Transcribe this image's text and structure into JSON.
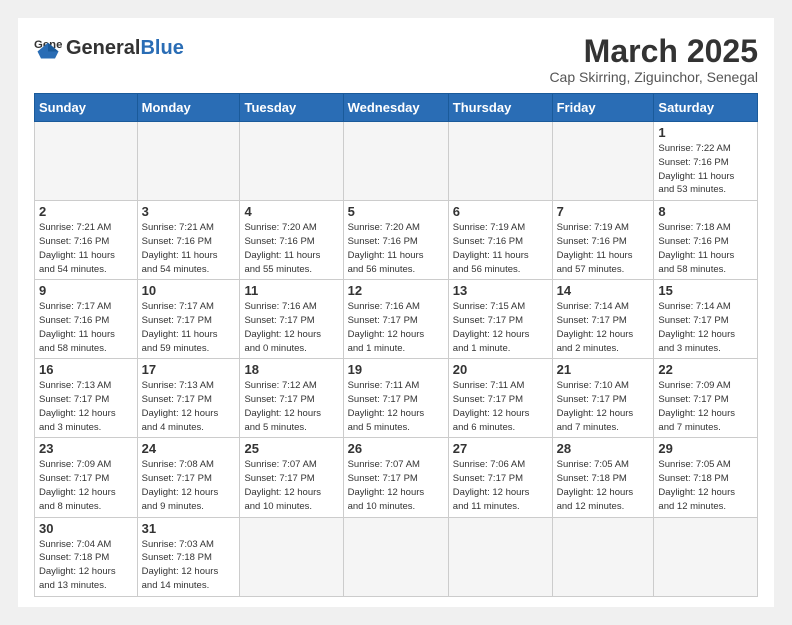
{
  "logo": {
    "text_general": "General",
    "text_blue": "Blue"
  },
  "header": {
    "title": "March 2025",
    "subtitle": "Cap Skirring, Ziguinchor, Senegal"
  },
  "weekdays": [
    "Sunday",
    "Monday",
    "Tuesday",
    "Wednesday",
    "Thursday",
    "Friday",
    "Saturday"
  ],
  "weeks": [
    [
      {
        "day": "",
        "info": ""
      },
      {
        "day": "",
        "info": ""
      },
      {
        "day": "",
        "info": ""
      },
      {
        "day": "",
        "info": ""
      },
      {
        "day": "",
        "info": ""
      },
      {
        "day": "",
        "info": ""
      },
      {
        "day": "1",
        "info": "Sunrise: 7:22 AM\nSunset: 7:16 PM\nDaylight: 11 hours\nand 53 minutes."
      }
    ],
    [
      {
        "day": "2",
        "info": "Sunrise: 7:21 AM\nSunset: 7:16 PM\nDaylight: 11 hours\nand 54 minutes."
      },
      {
        "day": "3",
        "info": "Sunrise: 7:21 AM\nSunset: 7:16 PM\nDaylight: 11 hours\nand 54 minutes."
      },
      {
        "day": "4",
        "info": "Sunrise: 7:20 AM\nSunset: 7:16 PM\nDaylight: 11 hours\nand 55 minutes."
      },
      {
        "day": "5",
        "info": "Sunrise: 7:20 AM\nSunset: 7:16 PM\nDaylight: 11 hours\nand 56 minutes."
      },
      {
        "day": "6",
        "info": "Sunrise: 7:19 AM\nSunset: 7:16 PM\nDaylight: 11 hours\nand 56 minutes."
      },
      {
        "day": "7",
        "info": "Sunrise: 7:19 AM\nSunset: 7:16 PM\nDaylight: 11 hours\nand 57 minutes."
      },
      {
        "day": "8",
        "info": "Sunrise: 7:18 AM\nSunset: 7:16 PM\nDaylight: 11 hours\nand 58 minutes."
      }
    ],
    [
      {
        "day": "9",
        "info": "Sunrise: 7:17 AM\nSunset: 7:16 PM\nDaylight: 11 hours\nand 58 minutes."
      },
      {
        "day": "10",
        "info": "Sunrise: 7:17 AM\nSunset: 7:17 PM\nDaylight: 11 hours\nand 59 minutes."
      },
      {
        "day": "11",
        "info": "Sunrise: 7:16 AM\nSunset: 7:17 PM\nDaylight: 12 hours\nand 0 minutes."
      },
      {
        "day": "12",
        "info": "Sunrise: 7:16 AM\nSunset: 7:17 PM\nDaylight: 12 hours\nand 1 minute."
      },
      {
        "day": "13",
        "info": "Sunrise: 7:15 AM\nSunset: 7:17 PM\nDaylight: 12 hours\nand 1 minute."
      },
      {
        "day": "14",
        "info": "Sunrise: 7:14 AM\nSunset: 7:17 PM\nDaylight: 12 hours\nand 2 minutes."
      },
      {
        "day": "15",
        "info": "Sunrise: 7:14 AM\nSunset: 7:17 PM\nDaylight: 12 hours\nand 3 minutes."
      }
    ],
    [
      {
        "day": "16",
        "info": "Sunrise: 7:13 AM\nSunset: 7:17 PM\nDaylight: 12 hours\nand 3 minutes."
      },
      {
        "day": "17",
        "info": "Sunrise: 7:13 AM\nSunset: 7:17 PM\nDaylight: 12 hours\nand 4 minutes."
      },
      {
        "day": "18",
        "info": "Sunrise: 7:12 AM\nSunset: 7:17 PM\nDaylight: 12 hours\nand 5 minutes."
      },
      {
        "day": "19",
        "info": "Sunrise: 7:11 AM\nSunset: 7:17 PM\nDaylight: 12 hours\nand 5 minutes."
      },
      {
        "day": "20",
        "info": "Sunrise: 7:11 AM\nSunset: 7:17 PM\nDaylight: 12 hours\nand 6 minutes."
      },
      {
        "day": "21",
        "info": "Sunrise: 7:10 AM\nSunset: 7:17 PM\nDaylight: 12 hours\nand 7 minutes."
      },
      {
        "day": "22",
        "info": "Sunrise: 7:09 AM\nSunset: 7:17 PM\nDaylight: 12 hours\nand 7 minutes."
      }
    ],
    [
      {
        "day": "23",
        "info": "Sunrise: 7:09 AM\nSunset: 7:17 PM\nDaylight: 12 hours\nand 8 minutes."
      },
      {
        "day": "24",
        "info": "Sunrise: 7:08 AM\nSunset: 7:17 PM\nDaylight: 12 hours\nand 9 minutes."
      },
      {
        "day": "25",
        "info": "Sunrise: 7:07 AM\nSunset: 7:17 PM\nDaylight: 12 hours\nand 10 minutes."
      },
      {
        "day": "26",
        "info": "Sunrise: 7:07 AM\nSunset: 7:17 PM\nDaylight: 12 hours\nand 10 minutes."
      },
      {
        "day": "27",
        "info": "Sunrise: 7:06 AM\nSunset: 7:17 PM\nDaylight: 12 hours\nand 11 minutes."
      },
      {
        "day": "28",
        "info": "Sunrise: 7:05 AM\nSunset: 7:18 PM\nDaylight: 12 hours\nand 12 minutes."
      },
      {
        "day": "29",
        "info": "Sunrise: 7:05 AM\nSunset: 7:18 PM\nDaylight: 12 hours\nand 12 minutes."
      }
    ],
    [
      {
        "day": "30",
        "info": "Sunrise: 7:04 AM\nSunset: 7:18 PM\nDaylight: 12 hours\nand 13 minutes."
      },
      {
        "day": "31",
        "info": "Sunrise: 7:03 AM\nSunset: 7:18 PM\nDaylight: 12 hours\nand 14 minutes."
      },
      {
        "day": "",
        "info": ""
      },
      {
        "day": "",
        "info": ""
      },
      {
        "day": "",
        "info": ""
      },
      {
        "day": "",
        "info": ""
      },
      {
        "day": "",
        "info": ""
      }
    ]
  ]
}
